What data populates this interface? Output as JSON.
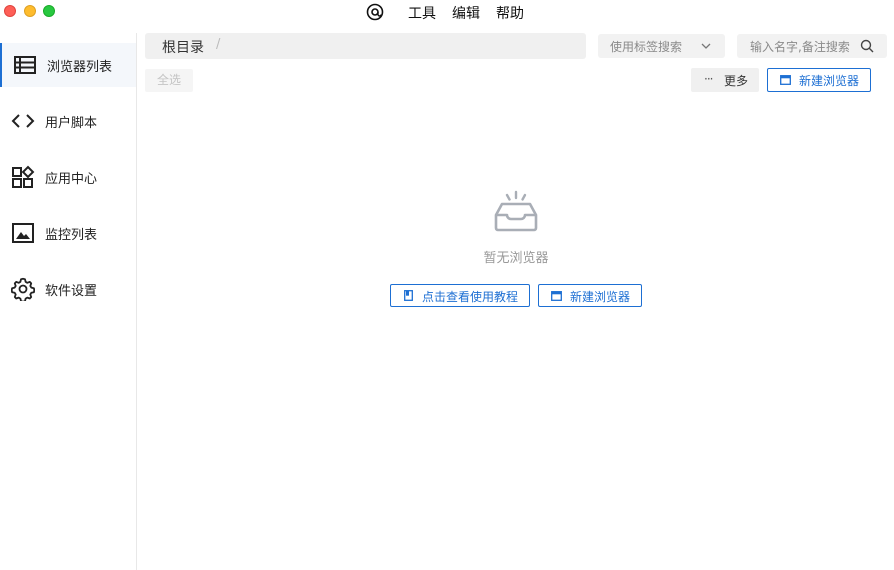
{
  "menubar": {
    "tools": "工具",
    "edit": "编辑",
    "help": "帮助"
  },
  "sidebar": {
    "items": [
      {
        "label": "浏览器列表",
        "icon": "list-icon",
        "active": true
      },
      {
        "label": "用户脚本",
        "icon": "code-icon",
        "active": false
      },
      {
        "label": "应用中心",
        "icon": "apps-icon",
        "active": false
      },
      {
        "label": "监控列表",
        "icon": "image-icon",
        "active": false
      },
      {
        "label": "软件设置",
        "icon": "gear-icon",
        "active": false
      }
    ]
  },
  "breadcrumb": {
    "root": "根目录",
    "separator": "/"
  },
  "tag_search": {
    "placeholder": "使用标签搜索"
  },
  "name_search": {
    "placeholder": "输入名字,备注搜索"
  },
  "toolbar": {
    "select_all": "全选",
    "more_dots": "···",
    "more": "更多",
    "new_browser": "新建浏览器"
  },
  "empty_state": {
    "message": "暂无浏览器",
    "tutorial": "点击查看使用教程",
    "new_browser": "新建浏览器"
  },
  "colors": {
    "accent": "#1d6fd3"
  }
}
